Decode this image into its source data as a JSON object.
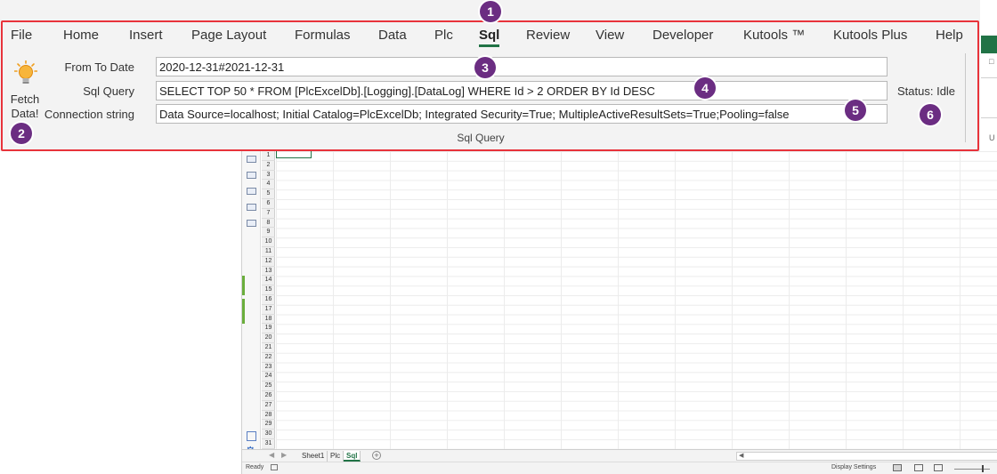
{
  "ribbon": {
    "tabs": [
      {
        "label": "File"
      },
      {
        "label": "Home"
      },
      {
        "label": "Insert"
      },
      {
        "label": "Page Layout"
      },
      {
        "label": "Formulas"
      },
      {
        "label": "Data"
      },
      {
        "label": "Plc"
      },
      {
        "label": "Sql",
        "active": true
      },
      {
        "label": "Review"
      },
      {
        "label": "View"
      },
      {
        "label": "Developer"
      },
      {
        "label": "Kutools ™"
      },
      {
        "label": "Kutools Plus"
      },
      {
        "label": "Help"
      }
    ],
    "fetch_button": {
      "line1": "Fetch",
      "line2": "Data!",
      "icon": "lightbulb-icon"
    },
    "fields": {
      "from_to_date": {
        "label": "From To Date",
        "value": "2020-12-31#2021-12-31"
      },
      "sql_query": {
        "label": "Sql Query",
        "value": "SELECT TOP 50 * FROM [PlcExcelDb].[Logging].[DataLog] WHERE Id > 2 ORDER BY Id DESC"
      },
      "connection_string": {
        "label": "Connection string",
        "value": "Data Source=localhost; Initial Catalog=PlcExcelDb; Integrated Security=True; MultipleActiveResultSets=True;Pooling=false"
      }
    },
    "status": "Status: Idle",
    "group_label": "Sql Query",
    "accent_color": "#217346",
    "highlight_color": "#e8333b"
  },
  "callouts": [
    "1",
    "2",
    "3",
    "4",
    "5",
    "6"
  ],
  "sheet": {
    "row_numbers": [
      "1",
      "2",
      "3",
      "4",
      "5",
      "6",
      "7",
      "8",
      "9",
      "10",
      "11",
      "12",
      "13",
      "14",
      "15",
      "16",
      "17",
      "18",
      "19",
      "20",
      "21",
      "22",
      "23",
      "24",
      "25",
      "26",
      "27",
      "28",
      "29",
      "30",
      "31"
    ],
    "tabs": [
      {
        "label": "Sheet1"
      },
      {
        "label": "Plc"
      },
      {
        "label": "Sql",
        "active": true
      }
    ],
    "add_sheet": "+",
    "nav_prev": "◀",
    "nav_next": "▶",
    "scroll_left": "◀"
  },
  "status_bar": {
    "ready": "Ready",
    "display_settings": "Display Settings"
  },
  "edge": {
    "glyph_top": "□",
    "glyph_mid": "U"
  }
}
